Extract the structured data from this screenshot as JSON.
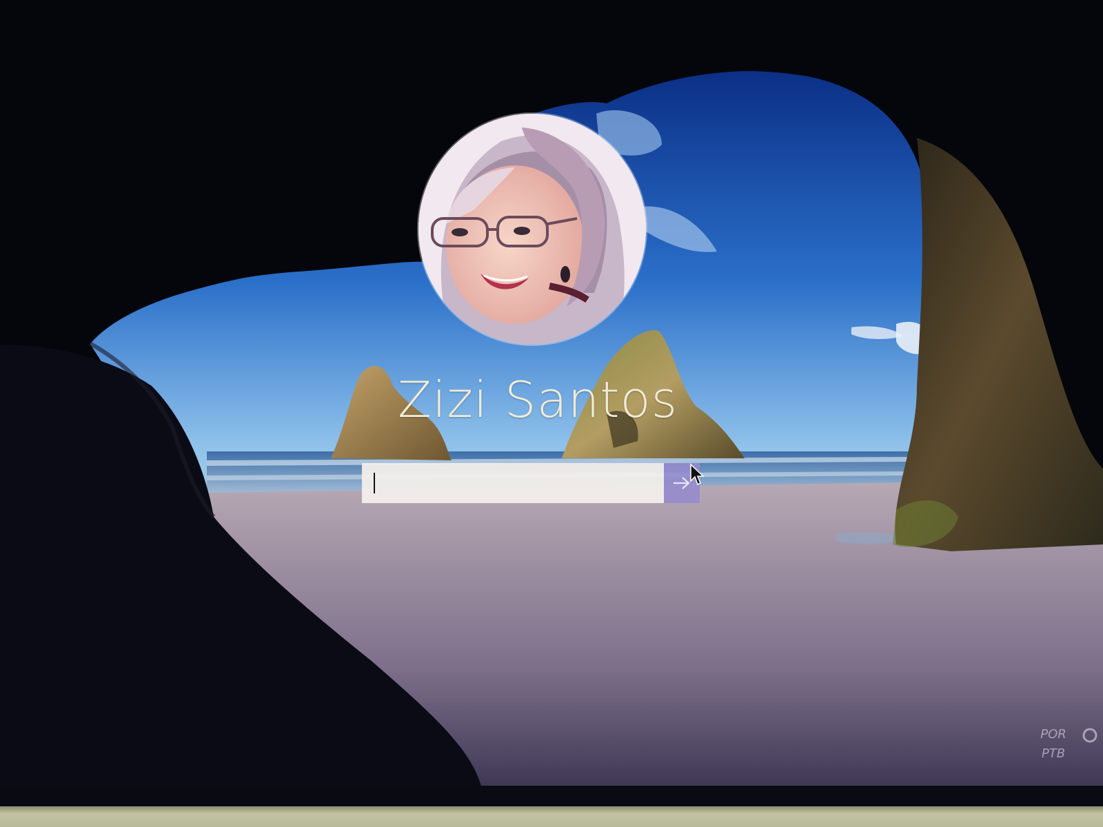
{
  "lock_screen": {
    "user_name": "Zizi Santos",
    "password": {
      "value": "",
      "placeholder": ""
    },
    "submit_icon": "arrow-right-icon"
  },
  "status": {
    "language_code": "POR",
    "keyboard_layout": "PTB",
    "network_icon": "network-icon"
  },
  "colors": {
    "name_text": "#f0ebd6",
    "submit_bg": "#968ccd",
    "input_bg": "#f4f0ec"
  }
}
